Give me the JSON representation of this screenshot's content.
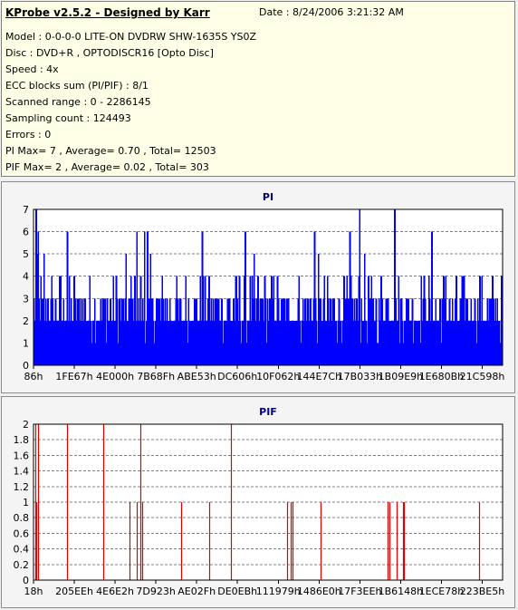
{
  "info": {
    "title": "KProbe v2.5.2 - Designed by Karr",
    "date": "Date : 8/24/2006 3:21:32 AM",
    "lines": [
      "Model : 0-0-0-0 LITE-ON DVDRW SHW-1635S  YS0Z",
      "Disc : DVD+R , OPTODISCR16 [Opto Disc]",
      "Speed : 4x",
      "ECC blocks sum (PI/PIF) : 8/1",
      "Scanned range : 0 - 2286145",
      "Sampling count : 124493",
      "Errors : 0",
      "PI Max= 7 , Average= 0.70 , Total= 12503",
      "PIF Max= 2 , Average= 0.02 , Total= 303"
    ]
  },
  "colors": {
    "pi": "#0000ff",
    "pif": "#e00000",
    "title": "#000080",
    "plot_bg": "#ffffff",
    "info_bg": "#ffffe7"
  },
  "chart_data": [
    {
      "type": "bar",
      "title": "PI",
      "ylim": [
        0,
        7
      ],
      "yticks": [
        0,
        1,
        2,
        3,
        4,
        5,
        6,
        7
      ],
      "grid": true,
      "xticks": [
        "86h",
        "1FE67h",
        "4E000h",
        "7B68Fh",
        "ABE53h",
        "DC606h",
        "10F062h",
        "144E7Ch",
        "17B033h",
        "1B09E9h",
        "1E680Bh",
        "21C598h"
      ],
      "description": "PI errors per sample, mostly 2-3 with peaks to 7",
      "n_samples": 480,
      "spikes": [
        {
          "pos": 0.004,
          "value": 7
        },
        {
          "pos": 0.009,
          "value": 6
        },
        {
          "pos": 0.02,
          "value": 5
        },
        {
          "pos": 0.07,
          "value": 6
        },
        {
          "pos": 0.22,
          "value": 6
        },
        {
          "pos": 0.235,
          "value": 6
        },
        {
          "pos": 0.243,
          "value": 6
        },
        {
          "pos": 0.36,
          "value": 6
        },
        {
          "pos": 0.45,
          "value": 6
        },
        {
          "pos": 0.6,
          "value": 6
        },
        {
          "pos": 0.675,
          "value": 6
        },
        {
          "pos": 0.695,
          "value": 7
        },
        {
          "pos": 0.77,
          "value": 7
        },
        {
          "pos": 0.85,
          "value": 6
        }
      ]
    },
    {
      "type": "bar",
      "title": "PIF",
      "ylim": [
        0,
        2
      ],
      "yticks": [
        0,
        0.2,
        0.4,
        0.6,
        0.8,
        1,
        1.2,
        1.4,
        1.6,
        1.8,
        2
      ],
      "grid": true,
      "xticks": [
        "18h",
        "205EEh",
        "4E6E2h",
        "7D923h",
        "AE02Fh",
        "DE0EBh",
        "111979h",
        "1486E0h",
        "17F3EEh",
        "1B6148h",
        "1ECE78h",
        "223BE5h"
      ],
      "points": [
        {
          "pos": 0.003,
          "value": 2
        },
        {
          "pos": 0.006,
          "value": 1
        },
        {
          "pos": 0.009,
          "value": 2
        },
        {
          "pos": 0.072,
          "value": 2
        },
        {
          "pos": 0.148,
          "value": 2
        },
        {
          "pos": 0.205,
          "value": 1
        },
        {
          "pos": 0.22,
          "value": 1
        },
        {
          "pos": 0.228,
          "value": 2
        },
        {
          "pos": 0.232,
          "value": 1
        },
        {
          "pos": 0.314,
          "value": 1
        },
        {
          "pos": 0.374,
          "value": 1
        },
        {
          "pos": 0.42,
          "value": 2
        },
        {
          "pos": 0.54,
          "value": 1
        },
        {
          "pos": 0.548,
          "value": 1
        },
        {
          "pos": 0.552,
          "value": 1
        },
        {
          "pos": 0.612,
          "value": 1
        },
        {
          "pos": 0.755,
          "value": 1
        },
        {
          "pos": 0.758,
          "value": 1
        },
        {
          "pos": 0.775,
          "value": 1
        },
        {
          "pos": 0.787,
          "value": 1
        },
        {
          "pos": 0.79,
          "value": 1
        },
        {
          "pos": 0.95,
          "value": 1
        }
      ]
    }
  ]
}
